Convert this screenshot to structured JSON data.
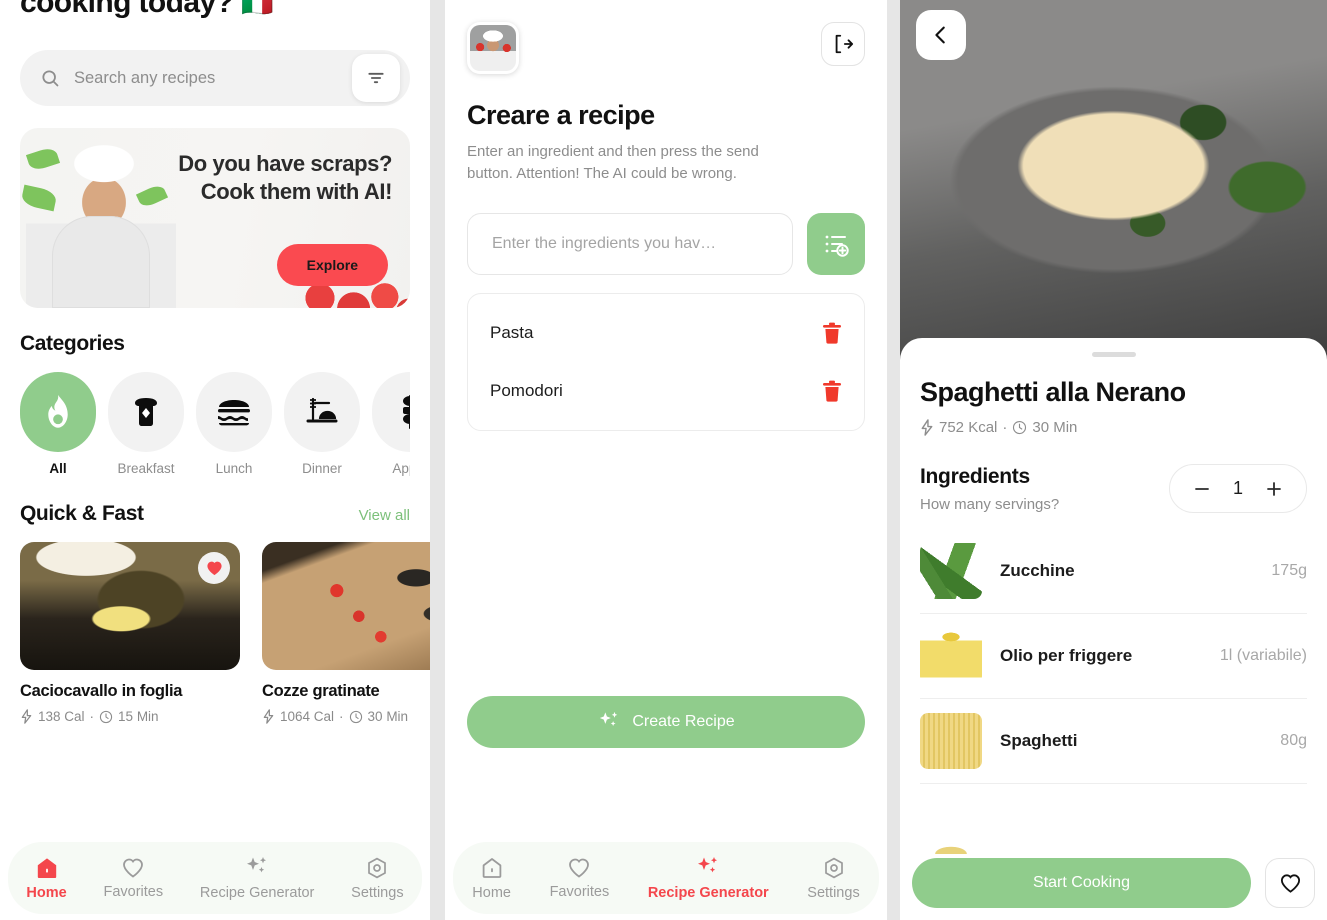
{
  "accent": {
    "green": "#90cc8c",
    "red": "#f4464c",
    "explore_red": "#fa4a50",
    "muted": "#8d8d8d"
  },
  "home": {
    "title": "cooking today?",
    "flag": "🇮🇹",
    "search": {
      "placeholder": "Search any recipes",
      "value": "",
      "icon": "search-icon"
    },
    "filter_icon": "filter-icon",
    "promo": {
      "line1": "Do you have scraps?",
      "line2": "Cook them with AI!",
      "button": "Explore"
    },
    "categories_title": "Categories",
    "categories": [
      {
        "label": "All",
        "icon": "flame-icon",
        "active": true
      },
      {
        "label": "Breakfast",
        "icon": "bread-icon",
        "active": false
      },
      {
        "label": "Lunch",
        "icon": "burger-icon",
        "active": false
      },
      {
        "label": "Dinner",
        "icon": "dinner-icon",
        "active": false
      },
      {
        "label": "Appet",
        "icon": "skewer-icon",
        "active": false
      }
    ],
    "quick_title": "Quick & Fast",
    "view_all": "View all",
    "cards": [
      {
        "name": "Caciocavallo in foglia",
        "cal": "138 Cal",
        "time": "15 Min",
        "favorited": true
      },
      {
        "name": "Cozze gratinate",
        "cal": "1064 Cal",
        "time": "30 Min",
        "favorited": false
      }
    ],
    "tabs": [
      {
        "label": "Home",
        "icon": "home-icon",
        "active": true
      },
      {
        "label": "Favorites",
        "icon": "heart-icon",
        "active": false
      },
      {
        "label": "Recipe Generator",
        "icon": "sparkles-icon",
        "active": false
      },
      {
        "label": "Settings",
        "icon": "gear-icon",
        "active": false
      }
    ]
  },
  "generator": {
    "avatar": "chef-avatar",
    "logout_icon": "logout-icon",
    "title": "Creare a recipe",
    "subtitle": "Enter an ingredient and then press the send button. Attention! The AI could be wrong.",
    "input": {
      "placeholder": "Enter the ingredients you hav…",
      "value": ""
    },
    "add_icon": "list-add-icon",
    "ingredients": [
      {
        "name": "Pasta",
        "delete_icon": "trash-icon"
      },
      {
        "name": "Pomodori",
        "delete_icon": "trash-icon"
      }
    ],
    "create_button": "Create Recipe",
    "create_icon": "sparkles-icon",
    "tabs": [
      {
        "label": "Home",
        "icon": "home-icon",
        "active": false
      },
      {
        "label": "Favorites",
        "icon": "heart-icon",
        "active": false
      },
      {
        "label": "Recipe Generator",
        "icon": "sparkles-icon",
        "active": true
      },
      {
        "label": "Settings",
        "icon": "gear-icon",
        "active": false
      }
    ]
  },
  "detail": {
    "back_icon": "chevron-left-icon",
    "hero": "spaghetti-photo",
    "title": "Spaghetti alla Nerano",
    "kcal": "752 Kcal",
    "time": "30 Min",
    "ingredients_title": "Ingredients",
    "servings_question": "How many servings?",
    "servings": "1",
    "minus_icon": "minus-icon",
    "plus_icon": "plus-icon",
    "ingredients": [
      {
        "name": "Zucchine",
        "amount": "175g",
        "thumb": "zucchini-thumb"
      },
      {
        "name": "Olio per friggere",
        "amount": "1l (variabile)",
        "thumb": "oil-thumb"
      },
      {
        "name": "Spaghetti",
        "amount": "80g",
        "thumb": "spaghetti-thumb"
      }
    ],
    "start_button": "Start Cooking",
    "favorite_icon": "heart-icon"
  }
}
